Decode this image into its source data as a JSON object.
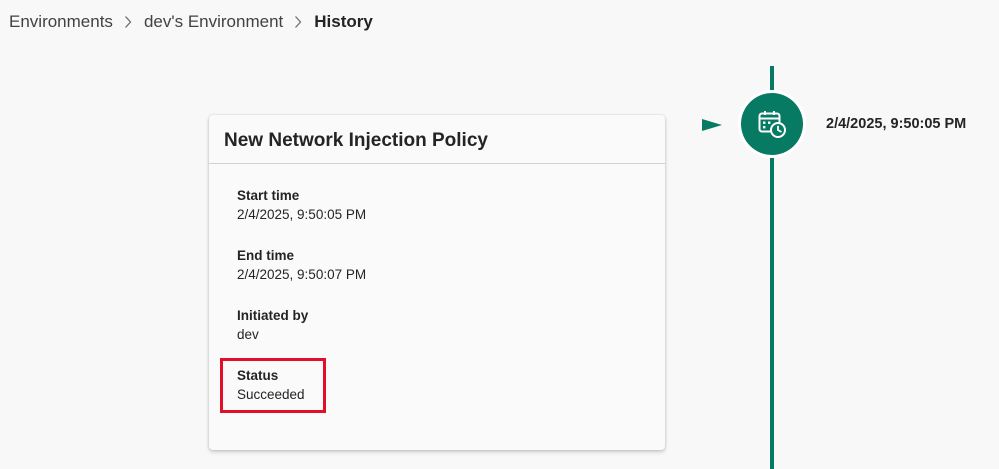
{
  "breadcrumb": {
    "items": [
      "Environments",
      "dev's Environment"
    ],
    "current": "History"
  },
  "card": {
    "title": "New Network Injection Policy",
    "fields": [
      {
        "label": "Start time",
        "value": "2/4/2025, 9:50:05 PM"
      },
      {
        "label": "End time",
        "value": "2/4/2025, 9:50:07 PM"
      },
      {
        "label": "Initiated by",
        "value": "dev"
      },
      {
        "label": "Status",
        "value": "Succeeded"
      }
    ]
  },
  "timeline": {
    "entries": [
      {
        "timestamp": "2/4/2025, 9:50:05 PM",
        "icon": "calendar-clock-icon"
      }
    ],
    "accent_color": "#077a64"
  },
  "highlight": {
    "target": "Status",
    "color": "#e0102b"
  }
}
